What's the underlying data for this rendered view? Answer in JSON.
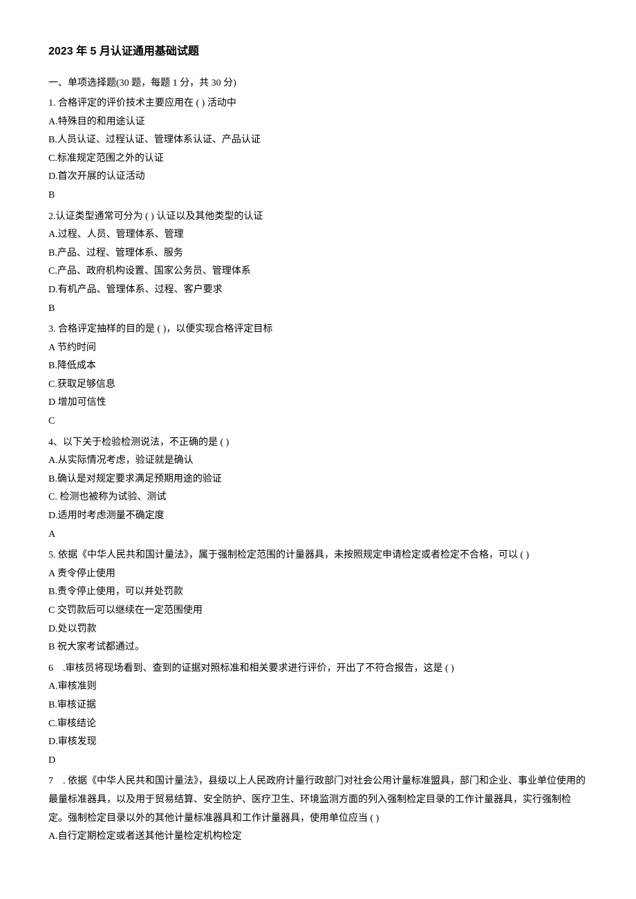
{
  "title": "2023 年 5 月认证通用基础试题",
  "section_header": "一、单项选择题(30 题，每题 1 分，共 30 分)",
  "q1": {
    "stem": "1. 合格评定的评价技术主要应用在 ( ) 活动中",
    "a": "A.特殊目的和用途认证",
    "b": "B.人员认证、过程认证、管理体系认证、产品认证",
    "c": "C.标准规定范围之外的认证",
    "d": "D.首次开展的认证活动",
    "ans": "B"
  },
  "q2": {
    "stem": "2.认证类型通常可分为 ( ) 认证以及其他类型的认证",
    "a": "A.过程、人员、管理体系、管理",
    "b": "B.产品、过程、管理体系、服务",
    "c": "C.产品、政府机构设置、国家公务员、管理体系",
    "d": "D.有机产品、管理体系、过程、客户要求",
    "ans": "B"
  },
  "q3": {
    "stem": "3. 合格评定抽样的目的是 ( )，以便实现合格评定目标",
    "a": "A 节约时间",
    "b": "B.降低成本",
    "c": "C.获取足够信息",
    "d": "D 增加可信性",
    "ans": "C"
  },
  "q4": {
    "stem": "4、以下关于检验检测说法，不正确的是 ( )",
    "a": "A.从实际情况考虑，验证就是确认",
    "b": "B.确认是对规定要求满足预期用途的验证",
    "c": "C. 检测也被称为试验、测试",
    "d": "D.适用时考虑测量不确定度",
    "ans": "A"
  },
  "q5": {
    "stem": "5. 依据《中华人民共和国计量法》，属于强制检定范围的计量器具，未按照规定申请检定或者检定不合格，可以 ( )",
    "a": "A 责令停止使用",
    "b": "B.责令停止使用，可以并处罚款",
    "c": "C 交罚款后可以继续在一定范围使用",
    "d": "D.处以罚款",
    "ans": "B 祝大家考试都通过。"
  },
  "q6": {
    "stem": "6　.审核员将现场看到、查到的证据对照标准和相关要求进行评价，开出了不符合报告，这是 ( )",
    "a": "A.审核准则",
    "b": "B.审核证据",
    "c": "C.审核结论",
    "d": "D.审核发现",
    "ans": "D"
  },
  "q7": {
    "stem": "7　. 依据《中华人民共和国计量法》，县级以上人民政府计量行政部门对社会公用计量标准盟具，部门和企业、事业单位使用的最量标准器具，以及用于贸易结算、安全防护、医疗卫生、环境监测方面的列入强制检定目录的工作计量器具，实行强制检定。强制检定目录以外的其他计量标准器具和工作计量器具，使用单位应当 ( )",
    "a": "A.自行定期检定或者送其他计量检定机构检定"
  }
}
